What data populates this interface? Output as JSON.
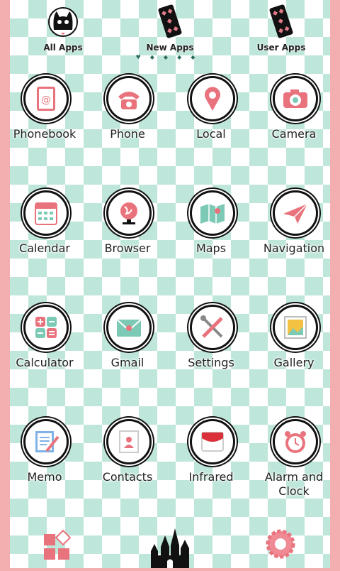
{
  "tabs": [
    {
      "label": "All Apps",
      "icon": "cat-icon"
    },
    {
      "label": "New Apps",
      "icon": "card-icon"
    },
    {
      "label": "User Apps",
      "icon": "card-icon"
    }
  ],
  "page_indicator": {
    "pages": 5,
    "current": 1
  },
  "apps": [
    {
      "label": "Phonebook",
      "icon": "phonebook-icon"
    },
    {
      "label": "Phone",
      "icon": "phone-icon"
    },
    {
      "label": "Local",
      "icon": "location-pin-icon"
    },
    {
      "label": "Camera",
      "icon": "camera-icon"
    },
    {
      "label": "Calendar",
      "icon": "calendar-icon"
    },
    {
      "label": "Browser",
      "icon": "globe-icon"
    },
    {
      "label": "Maps",
      "icon": "map-icon"
    },
    {
      "label": "Navigation",
      "icon": "paper-plane-icon"
    },
    {
      "label": "Calculator",
      "icon": "calculator-icon"
    },
    {
      "label": "Gmail",
      "icon": "envelope-icon"
    },
    {
      "label": "Settings",
      "icon": "tools-icon"
    },
    {
      "label": "Gallery",
      "icon": "picture-icon"
    },
    {
      "label": "Memo",
      "icon": "memo-icon"
    },
    {
      "label": "Contacts",
      "icon": "contact-card-icon"
    },
    {
      "label": "Infrared",
      "icon": "infrared-icon"
    },
    {
      "label": "Alarm and Clock",
      "icon": "alarm-clock-icon"
    }
  ],
  "dock": [
    {
      "icon": "app-drawer-icon"
    },
    {
      "icon": "castle-icon"
    },
    {
      "icon": "gear-icon"
    }
  ],
  "colors": {
    "mint": "#bfe6da",
    "pink": "#f3aeb0",
    "accent": "#e9737d",
    "ink": "#111111"
  }
}
